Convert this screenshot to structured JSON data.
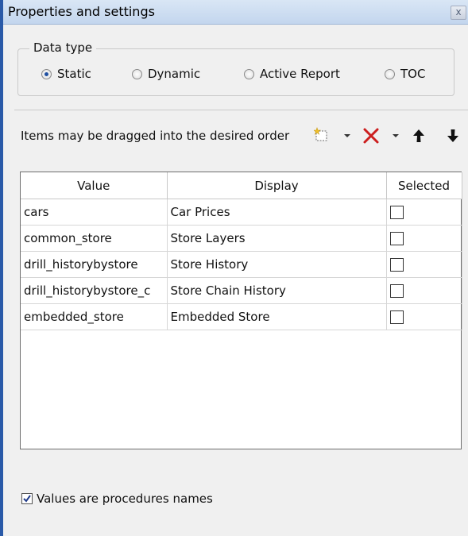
{
  "window": {
    "title": "Properties and settings",
    "close_glyph": "x"
  },
  "data_type": {
    "legend": "Data type",
    "options": [
      {
        "label": "Static",
        "checked": true
      },
      {
        "label": "Dynamic",
        "checked": false
      },
      {
        "label": "Active Report",
        "checked": false
      },
      {
        "label": "TOC",
        "checked": false
      }
    ]
  },
  "toolbar": {
    "hint": "Items may be dragged into the desired order",
    "icons": [
      "new-item-icon",
      "dropdown-arrow-icon",
      "delete-icon",
      "dropdown-arrow-icon",
      "move-up-icon",
      "move-down-icon"
    ],
    "delete_color": "#cc1e1e"
  },
  "grid": {
    "columns": [
      "Value",
      "Display",
      "Selected"
    ],
    "rows": [
      {
        "value": "cars",
        "display": "Car Prices",
        "selected": false
      },
      {
        "value": "common_store",
        "display": "Store Layers",
        "selected": false
      },
      {
        "value": "drill_historybystore",
        "display": "Store History",
        "selected": false
      },
      {
        "value": "drill_historybystore_c",
        "display": "Store Chain History",
        "selected": false
      },
      {
        "value": "embedded_store",
        "display": "Embedded Store",
        "selected": false
      }
    ]
  },
  "footer": {
    "checkbox_label": "Values are procedures names",
    "checked": true
  },
  "colors": {
    "accent": "#1f4fa0",
    "titlebar": "#c3d6ee"
  }
}
